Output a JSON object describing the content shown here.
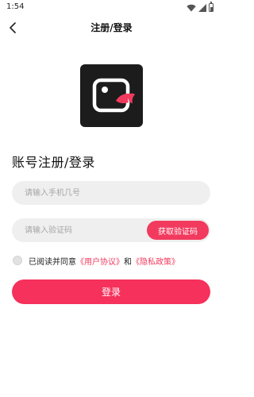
{
  "status_bar": {
    "time": "1:54",
    "icons": [
      "wifi-icon",
      "signal-icon",
      "battery-icon"
    ]
  },
  "nav": {
    "back_icon": "chevron-left-icon",
    "title": "注册/登录"
  },
  "logo": {
    "icon": "camera-icon",
    "background": "#1c1c1c",
    "accent": "#f23a5e"
  },
  "form": {
    "heading": "账号注册/登录",
    "phone": {
      "value": "",
      "placeholder": "请输入手机几号"
    },
    "code": {
      "value": "",
      "placeholder": "请输入验证码"
    },
    "get_code_label": "获取验证码"
  },
  "agreement": {
    "prefix": "已阅读并同意",
    "user_agreement": "《用户协议》",
    "conjunction": "和",
    "privacy_policy": "《隐私政策》"
  },
  "login_label": "登录",
  "colors": {
    "accent": "#f23a5e",
    "input_bg": "#efefef",
    "page_bg": "#ffffff"
  }
}
